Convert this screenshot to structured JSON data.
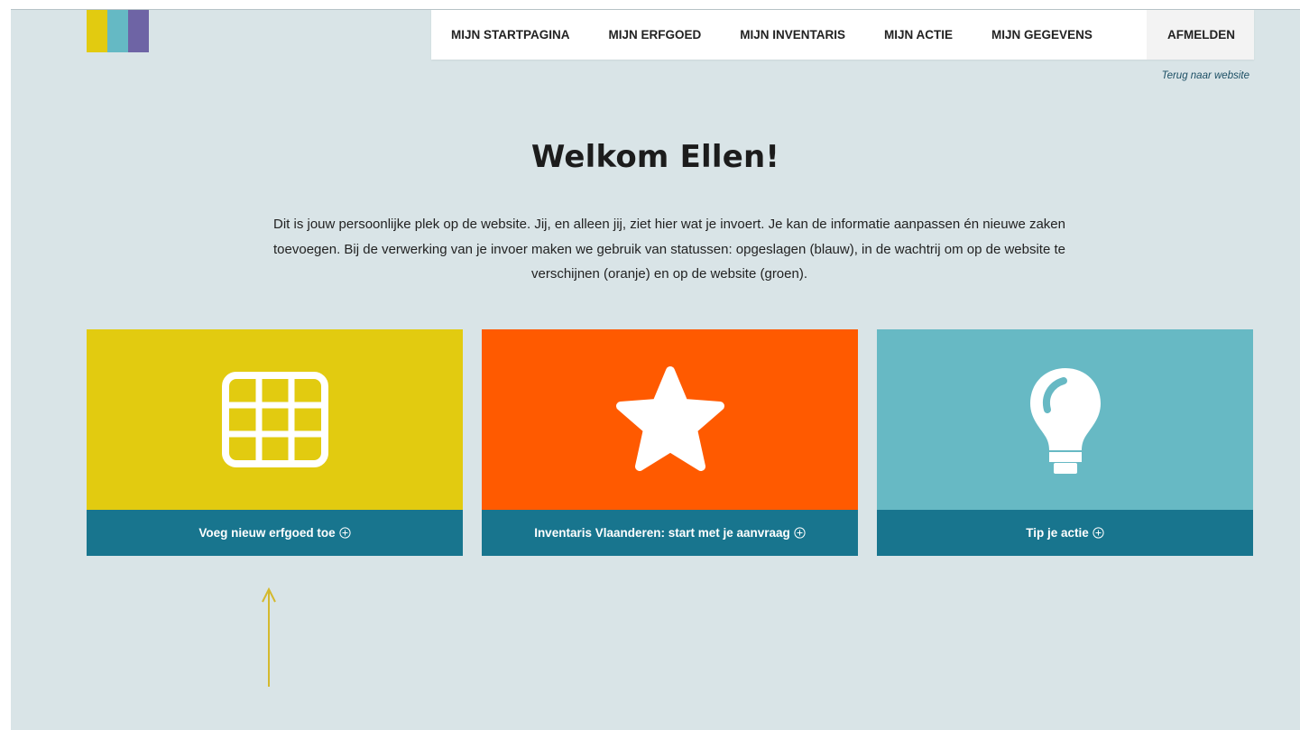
{
  "brand": {
    "logo_colors": [
      "#e2cb10",
      "#65b9c4",
      "#6e64a5"
    ]
  },
  "nav": {
    "items": [
      {
        "label": "MIJN STARTPAGINA"
      },
      {
        "label": "MIJN ERFGOED"
      },
      {
        "label": "MIJN INVENTARIS"
      },
      {
        "label": "MIJN ACTIE"
      },
      {
        "label": "MIJN GEGEVENS"
      }
    ],
    "logout_label": "AFMELDEN"
  },
  "back_link": "Terug naar website",
  "welcome": {
    "title": "Welkom Ellen!",
    "intro": "Dit is jouw persoonlijke plek op de website. Jij, en alleen jij, ziet hier wat je invoert. Je kan de informatie aanpassen én nieuwe zaken toevoegen. Bij de verwerking van je invoer maken we gebruik van statussen: opgeslagen (blauw), in de wachtrij om op de website te verschijnen (oranje) en op de website (groen)."
  },
  "cards": [
    {
      "label": "Voeg nieuw erfgoed toe",
      "icon": "grid-icon",
      "color": "#e2cb10"
    },
    {
      "label": "Inventaris Vlaanderen: start met je aanvraag",
      "icon": "star-icon",
      "color": "#ff5a00"
    },
    {
      "label": "Tip je actie",
      "icon": "lightbulb-icon",
      "color": "#67b9c4"
    }
  ],
  "colors": {
    "page_background": "#d9e4e7",
    "card_footer": "#18758e",
    "annotation_arrow": "#d4b92e"
  }
}
